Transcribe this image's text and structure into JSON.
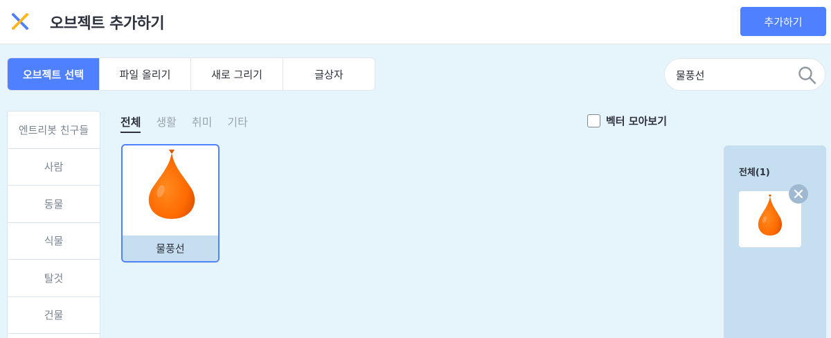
{
  "header": {
    "title": "오브젝트 추가하기",
    "add_button": "추가하기",
    "logo_icon": "close-x-icon",
    "logo_colors": [
      "#4f80ff",
      "#ffb61b"
    ]
  },
  "tabs": [
    {
      "label": "오브젝트 선택",
      "active": true
    },
    {
      "label": "파일 올리기",
      "active": false
    },
    {
      "label": "새로 그리기",
      "active": false
    },
    {
      "label": "글상자",
      "active": false
    }
  ],
  "search": {
    "value": "물풍선",
    "icon": "search-icon"
  },
  "categories": [
    "엔트리봇 친구들",
    "사람",
    "동물",
    "식물",
    "탈것",
    "건물"
  ],
  "subtabs": [
    {
      "label": "전체",
      "active": true
    },
    {
      "label": "생활",
      "active": false
    },
    {
      "label": "취미",
      "active": false
    },
    {
      "label": "기타",
      "active": false
    }
  ],
  "vector_toggle": {
    "label": "벡터 모아보기",
    "checked": false
  },
  "results": [
    {
      "name": "물풍선",
      "icon": "water-balloon-image",
      "selected": true
    }
  ],
  "selected_panel": {
    "count_label": "전체(1)",
    "items": [
      {
        "icon": "water-balloon-image",
        "remove_icon": "close-icon"
      }
    ]
  },
  "colors": {
    "accent": "#4f80ff",
    "background": "#e6f4fc",
    "balloon": "#ff6a00"
  }
}
